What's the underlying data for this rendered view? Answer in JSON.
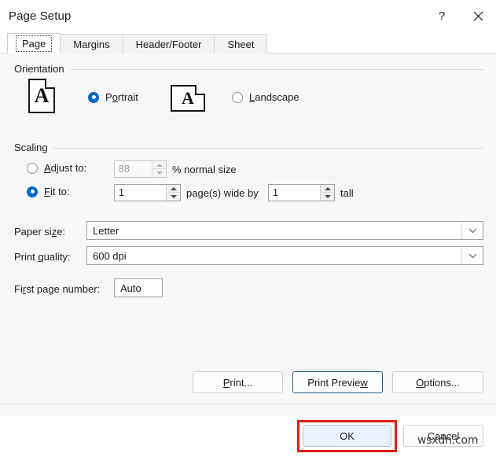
{
  "window": {
    "title": "Page Setup",
    "help_icon": "help-question-icon",
    "help_glyph": "?",
    "close_icon": "close-x-icon"
  },
  "tabs": [
    {
      "label": "Page",
      "active": true
    },
    {
      "label": "Margins",
      "active": false
    },
    {
      "label": "Header/Footer",
      "active": false
    },
    {
      "label": "Sheet",
      "active": false
    }
  ],
  "orientation": {
    "group_label": "Orientation",
    "portrait": {
      "label_pre": "P",
      "label_accel": "o",
      "label_post": "rtrait",
      "label_full": "Portrait",
      "selected": true,
      "icon": "portrait-page-icon",
      "icon_letter": "A"
    },
    "landscape": {
      "label_pre": "",
      "label_accel": "L",
      "label_post": "andscape",
      "label_full": "Landscape",
      "selected": false,
      "icon": "landscape-page-icon",
      "icon_letter": "A"
    }
  },
  "scaling": {
    "group_label": "Scaling",
    "adjust": {
      "label_pre": "",
      "label_accel": "A",
      "label_post": "djust to:",
      "label_full": "Adjust to:",
      "selected": false,
      "enabled": false,
      "value": "88",
      "suffix": "% normal size"
    },
    "fit": {
      "label_pre": "",
      "label_accel": "F",
      "label_post": "it to:",
      "label_full": "Fit to:",
      "selected": true,
      "enabled": true,
      "wide_value": "1",
      "middle_text": "page(s) wide by",
      "tall_value": "1",
      "tall_text": "tall"
    }
  },
  "paper": {
    "paper_size": {
      "label_pre": "Paper si",
      "label_accel": "z",
      "label_post": "e:",
      "label_full": "Paper size:",
      "value": "Letter",
      "arrow_icon": "chevron-down-icon"
    },
    "print_quality": {
      "label_pre": "Print ",
      "label_accel": "q",
      "label_post": "uality:",
      "label_full": "Print quality:",
      "value": "600 dpi",
      "arrow_icon": "chevron-down-icon"
    },
    "first_page_number": {
      "label_pre": "Fi",
      "label_accel": "r",
      "label_post": "st page number:",
      "label_full": "First page number:",
      "value": "Auto"
    }
  },
  "actions": {
    "print": {
      "label_pre": "",
      "label_accel": "P",
      "label_post": "rint...",
      "label_full": "Print..."
    },
    "print_preview": {
      "label_pre": "Print Previe",
      "label_accel": "w",
      "label_post": "",
      "label_full": "Print Preview",
      "is_default": true
    },
    "options": {
      "label_pre": "",
      "label_accel": "O",
      "label_post": "ptions...",
      "label_full": "Options..."
    },
    "ok": {
      "label": "OK",
      "highlighted": true
    },
    "cancel": {
      "label": "Cancel"
    }
  },
  "annotation": {
    "highlight_color": "#e01b16",
    "accent_color": "#0068c9",
    "default_button_border": "#1b628c"
  },
  "watermark": {
    "text": "wsxdn.com"
  }
}
